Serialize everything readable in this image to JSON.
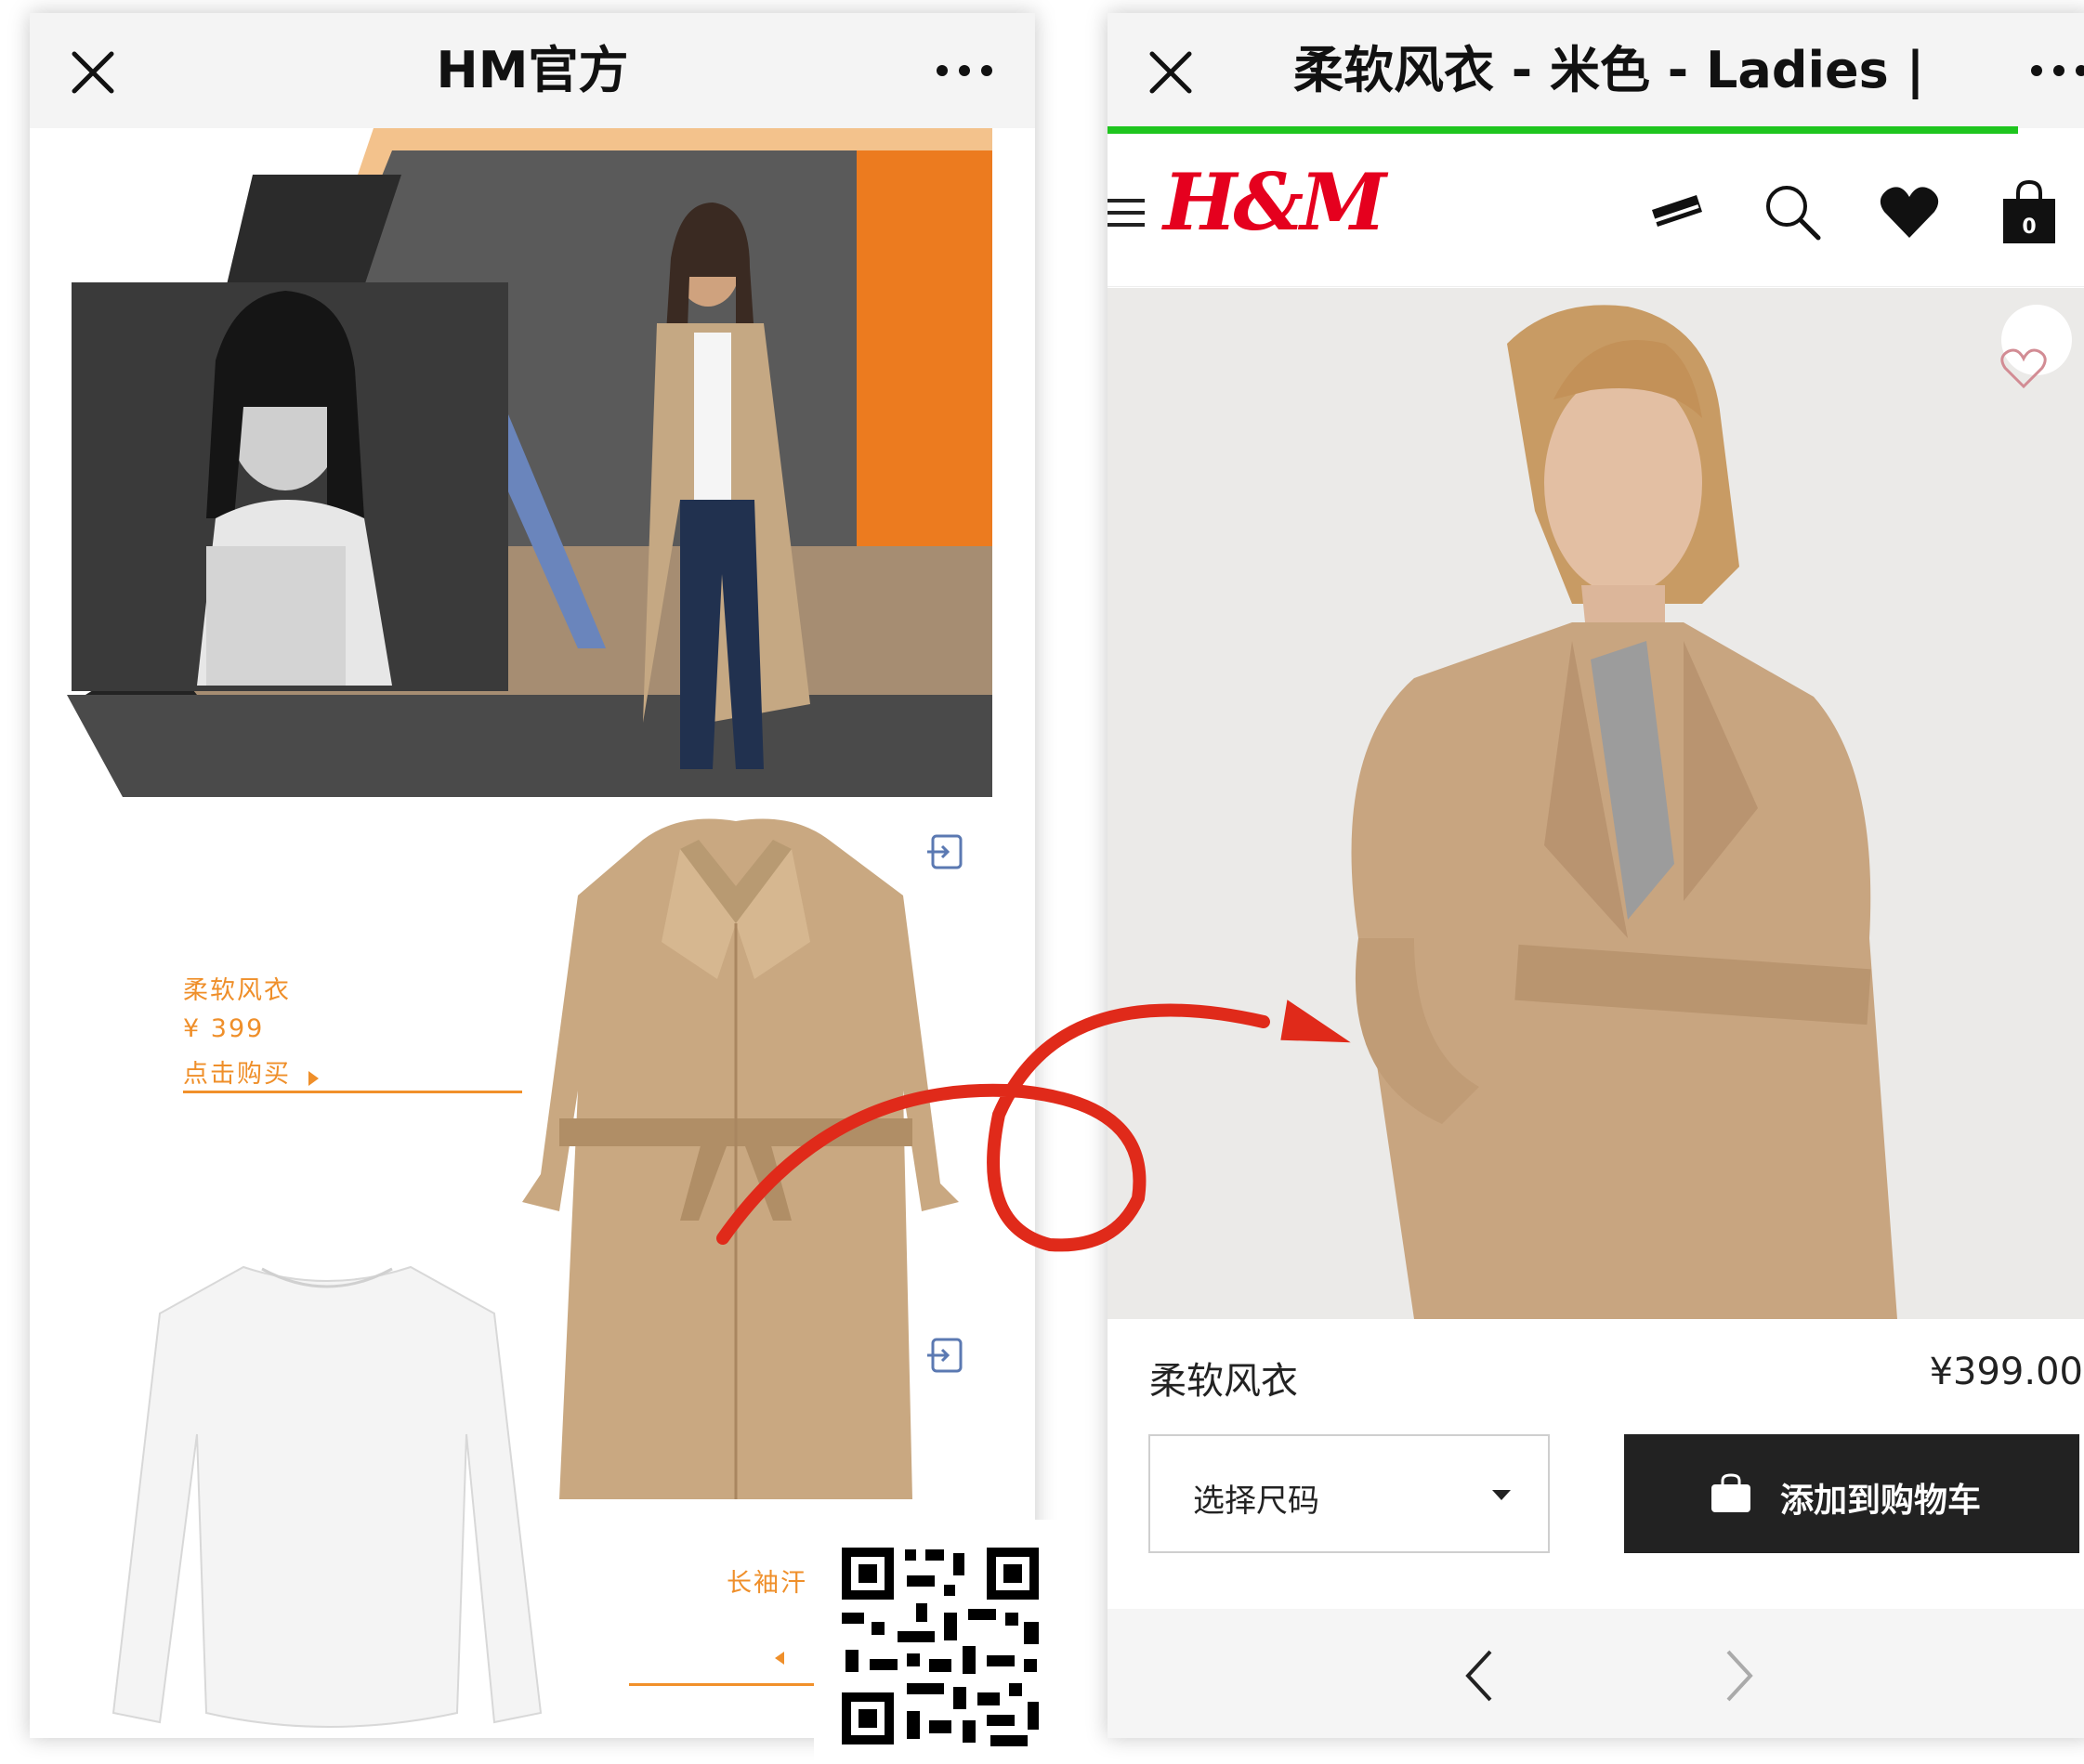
{
  "left_phone": {
    "title": "HM官方",
    "product": {
      "name": "柔软风衣",
      "price": "¥ 399",
      "cta": "点击购买"
    },
    "second_product": {
      "name_partial": "长袖汗"
    }
  },
  "right_phone": {
    "title": "柔软风衣 - 米色 - Ladies | H&",
    "brand": "H&M",
    "cart_count": "0",
    "product": {
      "name": "柔软风衣",
      "price": "¥399.00"
    },
    "size_select": {
      "label": "选择尺码"
    },
    "add_to_cart": {
      "label": "添加到购物车"
    }
  },
  "colors": {
    "accent_orange": "#f1902a",
    "hm_red": "#e5001e",
    "progress_green": "#1ec51e",
    "annotation_red": "#e02a1a",
    "coat_beige": "#c9a881"
  }
}
